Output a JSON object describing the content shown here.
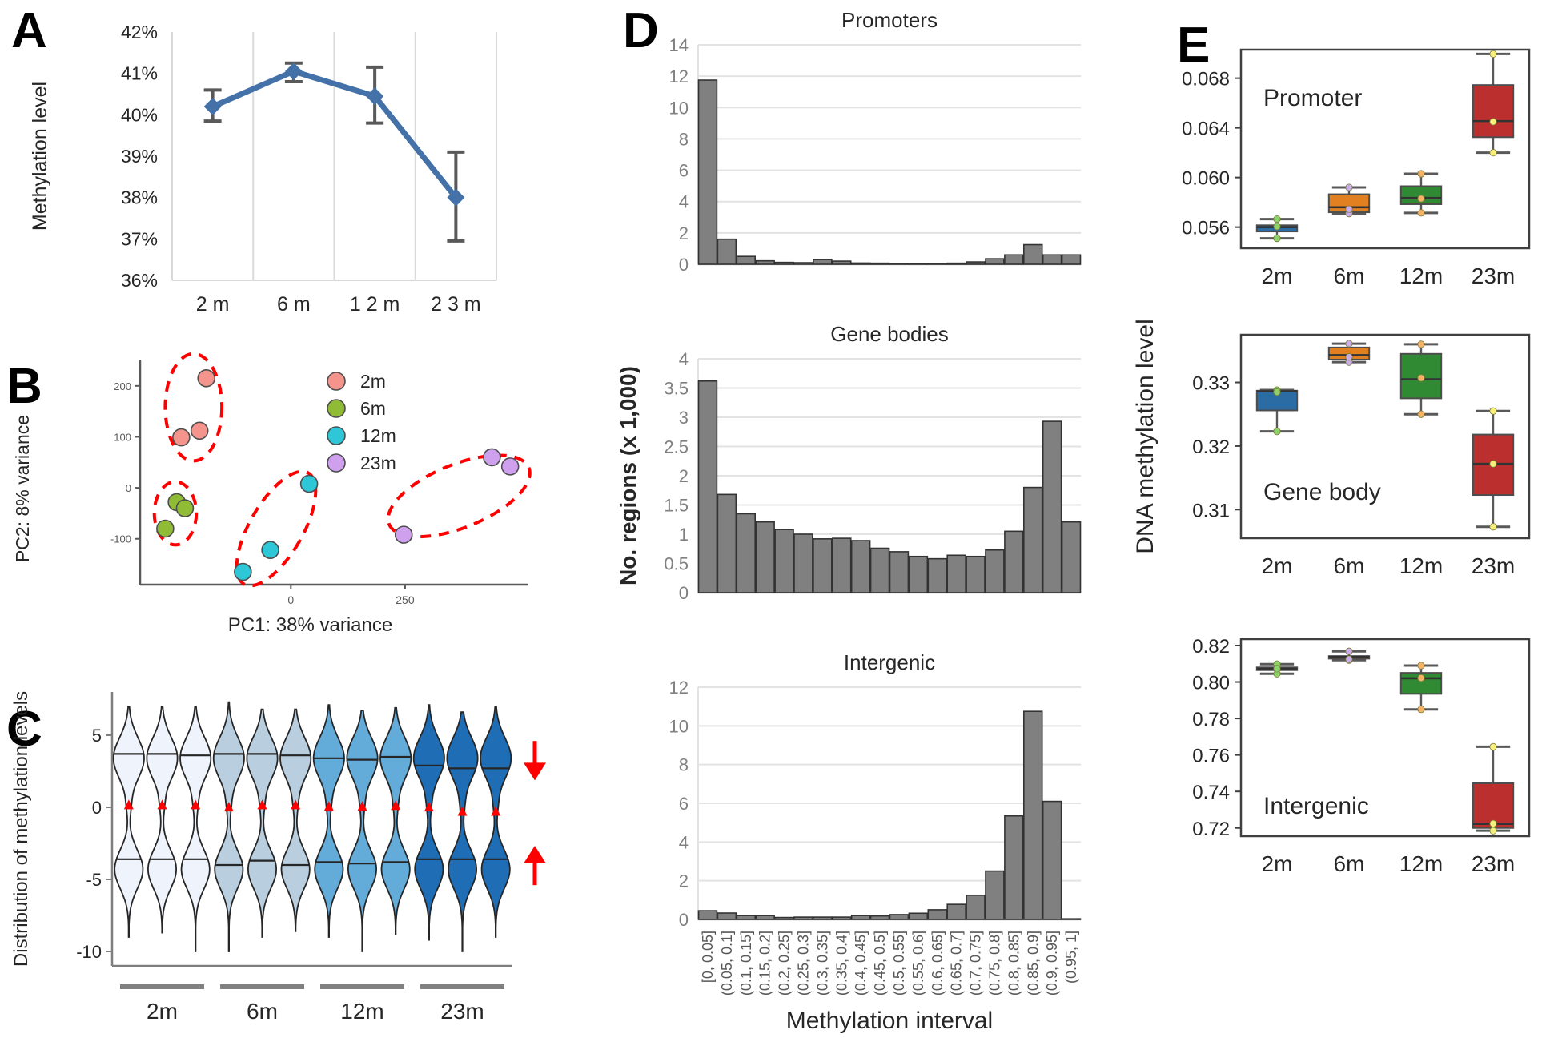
{
  "figure": {
    "panels": [
      "A",
      "B",
      "C",
      "D",
      "E"
    ]
  },
  "panelA": {
    "letter": "A",
    "ylabel": "Methylation level",
    "yticks": [
      "42%",
      "41%",
      "40%",
      "39%",
      "38%",
      "37%",
      "36%"
    ],
    "xticks": [
      "2 m",
      "6 m",
      "1 2 m",
      "2 3 m"
    ],
    "series_color": "#4472a8",
    "errorbar_color": "#595959"
  },
  "panelB": {
    "letter": "B",
    "ylabel": "PC2: 8% variance",
    "xlabel": "PC1: 38% variance",
    "yticks": [
      "200",
      "100",
      "0",
      "-100"
    ],
    "xticks": [
      "0",
      "250"
    ],
    "legend": [
      {
        "label": "2m",
        "color": "#f4948c"
      },
      {
        "label": "6m",
        "color": "#8fbc34"
      },
      {
        "label": "12m",
        "color": "#2ec7d8"
      },
      {
        "label": "23m",
        "color": "#cfa0ee"
      }
    ],
    "cluster_outline_color": "#ff0000"
  },
  "panelC": {
    "letter": "C",
    "ylabel": "Distribution of methylation levels",
    "yticks": [
      "5",
      "0",
      "-5",
      "-10"
    ],
    "group_labels": [
      "2m",
      "6m",
      "12m",
      "23m"
    ],
    "arrow_color": "#ff0000",
    "median_marker_color": "#ff0000",
    "violin_colors": [
      "#eef3fc",
      "#b9cfdf",
      "#63abd8",
      "#1f6eb5"
    ]
  },
  "panelD": {
    "letter": "D",
    "ylabel": "No. regions (x 1,000)",
    "xlabel": "Methylation interval",
    "bar_color": "#808080",
    "bar_edge": "#333333",
    "charts": [
      {
        "title": "Promoters",
        "yticks": [
          "14",
          "12",
          "10",
          "8",
          "6",
          "4",
          "2",
          "0"
        ]
      },
      {
        "title": "Gene bodies",
        "yticks": [
          "4",
          "3.5",
          "3",
          "2.5",
          "2",
          "1.5",
          "1",
          "0.5",
          "0"
        ]
      },
      {
        "title": "Intergenic",
        "yticks": [
          "12",
          "10",
          "8",
          "6",
          "4",
          "2",
          "0"
        ]
      }
    ],
    "xtick_labels": [
      "[0, 0.05]",
      "(0.05, 0.1]",
      "(0.1, 0.15]",
      "(0.15, 0.2]",
      "(0.2, 0.25]",
      "(0.25, 0.3]",
      "(0.3, 0.35]",
      "(0.35, 0.4]",
      "(0.4, 0.45]",
      "(0.45, 0.5]",
      "(0.5, 0.55]",
      "(0.55, 0.6]",
      "(0.6, 0.65]",
      "(0.65, 0.7]",
      "(0.7, 0.75]",
      "(0.75, 0.8]",
      "(0.8, 0.85]",
      "(0.85, 0.9]",
      "(0.9, 0.95]",
      "(0.95, 1]"
    ]
  },
  "panelE": {
    "letter": "E",
    "ylabel": "DNA methylation level",
    "xticks": [
      "2m",
      "6m",
      "12m",
      "23m"
    ],
    "box_colors": [
      "#2a6ca3",
      "#e08020",
      "#2f8a33",
      "#bb2f2f"
    ],
    "charts": [
      {
        "inner_title": "Promoter",
        "yticks": [
          "0.068",
          "0.064",
          "0.060",
          "0.056"
        ]
      },
      {
        "inner_title": "Gene body",
        "yticks": [
          "0.33",
          "0.32",
          "0.31"
        ]
      },
      {
        "inner_title": "Intergenic",
        "yticks": [
          "0.82",
          "0.80",
          "0.78",
          "0.76",
          "0.74",
          "0.72"
        ]
      }
    ]
  },
  "chart_data": [
    {
      "panel": "A",
      "type": "line",
      "title": "",
      "xlabel": "",
      "ylabel": "Methylation level",
      "categories": [
        "2 m",
        "6 m",
        "1 2 m",
        "2 3 m"
      ],
      "values": [
        40.2,
        41.05,
        40.45,
        38.0
      ],
      "error_low": [
        39.85,
        40.8,
        39.8,
        36.95
      ],
      "error_high": [
        40.6,
        41.25,
        41.15,
        39.1
      ],
      "ylim": [
        36,
        42
      ],
      "yticks": [
        36,
        37,
        38,
        39,
        40,
        41,
        42
      ],
      "units": "percent",
      "grid": "vertical",
      "legend": "none"
    },
    {
      "panel": "B",
      "type": "scatter",
      "title": "",
      "xlabel": "PC1: 38% variance",
      "ylabel": "PC2: 8% variance",
      "xlim": [
        -330,
        520
      ],
      "ylim": [
        -190,
        250
      ],
      "xticks": [
        0,
        250
      ],
      "yticks": [
        -100,
        0,
        100,
        200
      ],
      "grid": "off",
      "legend": "inside-right",
      "series": [
        {
          "name": "2m",
          "color": "#f4948c",
          "points": [
            [
              -185,
              215
            ],
            [
              -240,
              99
            ],
            [
              -200,
              112
            ]
          ]
        },
        {
          "name": "6m",
          "color": "#8fbc34",
          "points": [
            [
              -250,
              -28
            ],
            [
              -232,
              -40
            ],
            [
              -275,
              -80
            ]
          ]
        },
        {
          "name": "12m",
          "color": "#2ec7d8",
          "points": [
            [
              40,
              8
            ],
            [
              -45,
              -122
            ],
            [
              -105,
              -165
            ]
          ]
        },
        {
          "name": "23m",
          "color": "#cfa0ee",
          "points": [
            [
              440,
              60
            ],
            [
              480,
              42
            ],
            [
              247,
              -92
            ]
          ]
        }
      ],
      "annotations": [
        {
          "type": "ellipse",
          "label": "2m cluster",
          "color": "#ff0000",
          "style": "dashed"
        },
        {
          "type": "ellipse",
          "label": "6m cluster",
          "color": "#ff0000",
          "style": "dashed"
        },
        {
          "type": "ellipse",
          "label": "12m cluster",
          "color": "#ff0000",
          "style": "dashed"
        },
        {
          "type": "ellipse",
          "label": "23m cluster",
          "color": "#ff0000",
          "style": "dashed"
        }
      ]
    },
    {
      "panel": "C",
      "type": "violin",
      "title": "",
      "xlabel": "",
      "ylabel": "Distribution of methylation levels",
      "ylim": [
        -11,
        8
      ],
      "yticks": [
        -10,
        -5,
        0,
        5
      ],
      "groups": [
        "2m",
        "6m",
        "12m",
        "23m"
      ],
      "replicates_per_group": 3,
      "upper_medians": [
        3.7,
        3.7,
        3.6,
        3.7,
        3.7,
        3.6,
        3.4,
        3.3,
        3.5,
        2.9,
        2.7,
        2.7
      ],
      "lower_medians": [
        -3.6,
        -3.6,
        -3.6,
        -4.0,
        -3.7,
        -4.0,
        -3.8,
        -3.9,
        -3.8,
        -3.6,
        -3.6,
        -3.6
      ],
      "red_triangle_y": [
        0.2,
        0.2,
        0.2,
        0.05,
        0.2,
        0.2,
        0.1,
        0.1,
        0.15,
        0.05,
        -0.25,
        -0.25
      ],
      "whisker_top": [
        7.0,
        7.0,
        7.0,
        7.3,
        6.8,
        6.8,
        7.1,
        6.7,
        6.9,
        7.1,
        6.6,
        7.0
      ],
      "whisker_bottom": [
        -9.0,
        -8.7,
        -10.0,
        -10.0,
        -9.0,
        -8.6,
        -9.0,
        -10.0,
        -8.8,
        -9.2,
        -10.0,
        -9.0
      ],
      "annotations": [
        {
          "type": "arrow",
          "direction": "down",
          "color": "#ff0000",
          "near_y": 3
        },
        {
          "type": "arrow",
          "direction": "up",
          "color": "#ff0000",
          "near_y": -4
        }
      ],
      "grid": "off",
      "legend": "none"
    },
    {
      "panel": "D",
      "chart": "Promoters",
      "type": "bar",
      "title": "Promoters",
      "xlabel": "Methylation interval",
      "ylabel": "No. regions (x 1,000)",
      "categories": [
        "[0, 0.05]",
        "(0.05, 0.1]",
        "(0.1, 0.15]",
        "(0.15, 0.2]",
        "(0.2, 0.25]",
        "(0.25, 0.3]",
        "(0.3, 0.35]",
        "(0.35, 0.4]",
        "(0.4, 0.45]",
        "(0.45, 0.5]",
        "(0.5, 0.55]",
        "(0.55, 0.6]",
        "(0.6, 0.65]",
        "(0.65, 0.7]",
        "(0.7, 0.75]",
        "(0.75, 0.8]",
        "(0.8, 0.85]",
        "(0.85, 0.9]",
        "(0.9, 0.95]",
        "(0.95, 1]"
      ],
      "values": [
        11.75,
        1.6,
        0.5,
        0.22,
        0.12,
        0.1,
        0.3,
        0.2,
        0.08,
        0.07,
        0.05,
        0.03,
        0.05,
        0.07,
        0.15,
        0.35,
        0.6,
        1.25,
        0.6,
        0.6
      ],
      "ylim": [
        0,
        14
      ],
      "yticks": [
        0,
        2,
        4,
        6,
        8,
        10,
        12,
        14
      ],
      "grid": "horizontal"
    },
    {
      "panel": "D",
      "chart": "Gene bodies",
      "type": "bar",
      "title": "Gene bodies",
      "xlabel": "Methylation interval",
      "ylabel": "No. regions (x 1,000)",
      "categories": [
        "[0, 0.05]",
        "(0.05, 0.1]",
        "(0.1, 0.15]",
        "(0.15, 0.2]",
        "(0.2, 0.25]",
        "(0.25, 0.3]",
        "(0.3, 0.35]",
        "(0.35, 0.4]",
        "(0.4, 0.45]",
        "(0.45, 0.5]",
        "(0.5, 0.55]",
        "(0.55, 0.6]",
        "(0.6, 0.65]",
        "(0.65, 0.7]",
        "(0.7, 0.75]",
        "(0.75, 0.8]",
        "(0.8, 0.85]",
        "(0.85, 0.9]",
        "(0.9, 0.95]",
        "(0.95, 1]"
      ],
      "values": [
        3.62,
        1.68,
        1.35,
        1.21,
        1.08,
        1.0,
        0.92,
        0.93,
        0.89,
        0.76,
        0.7,
        0.62,
        0.58,
        0.64,
        0.62,
        0.73,
        1.05,
        1.8,
        2.93,
        1.21
      ],
      "ylim": [
        0,
        4
      ],
      "yticks": [
        0,
        0.5,
        1,
        1.5,
        2,
        2.5,
        3,
        3.5,
        4
      ],
      "grid": "horizontal"
    },
    {
      "panel": "D",
      "chart": "Intergenic",
      "type": "bar",
      "title": "Intergenic",
      "xlabel": "Methylation interval",
      "ylabel": "No. regions (x 1,000)",
      "categories": [
        "[0, 0.05]",
        "(0.05, 0.1]",
        "(0.1, 0.15]",
        "(0.15, 0.2]",
        "(0.2, 0.25]",
        "(0.25, 0.3]",
        "(0.3, 0.35]",
        "(0.35, 0.4]",
        "(0.4, 0.45]",
        "(0.45, 0.5]",
        "(0.5, 0.55]",
        "(0.55, 0.6]",
        "(0.6, 0.65]",
        "(0.65, 0.7]",
        "(0.7, 0.75]",
        "(0.75, 0.8]",
        "(0.8, 0.85]",
        "(0.85, 0.9]",
        "(0.9, 0.95]",
        "(0.95, 1]"
      ],
      "values": [
        0.45,
        0.33,
        0.2,
        0.2,
        0.1,
        0.12,
        0.12,
        0.12,
        0.2,
        0.18,
        0.25,
        0.32,
        0.5,
        0.78,
        1.25,
        2.5,
        5.35,
        10.75,
        6.1,
        0.0
      ],
      "ylim": [
        0,
        12
      ],
      "yticks": [
        0,
        2,
        4,
        6,
        8,
        10,
        12
      ],
      "grid": "horizontal"
    },
    {
      "panel": "E",
      "chart": "Promoter",
      "type": "boxplot",
      "title": "Promoter",
      "xlabel": "",
      "ylabel": "DNA methylation level",
      "categories": [
        "2m",
        "6m",
        "12m",
        "23m"
      ],
      "ylim": [
        0.0543,
        0.0703
      ],
      "yticks": [
        0.056,
        0.06,
        0.064,
        0.068
      ],
      "boxes": [
        {
          "name": "2m",
          "color": "#2a6ca3",
          "whisker_low": 0.0551,
          "q1": 0.05565,
          "median": 0.056,
          "q3": 0.05615,
          "whisker_high": 0.05665,
          "point": 0.05605
        },
        {
          "name": "6m",
          "color": "#e08020",
          "whisker_low": 0.0571,
          "q1": 0.0572,
          "median": 0.0576,
          "q3": 0.05865,
          "whisker_high": 0.0592,
          "point": 0.05745
        },
        {
          "name": "12m",
          "color": "#2f8a33",
          "whisker_low": 0.05715,
          "q1": 0.05785,
          "median": 0.05835,
          "q3": 0.0593,
          "whisker_high": 0.0603,
          "point": 0.0583
        },
        {
          "name": "23m",
          "color": "#bb2f2f",
          "whisker_low": 0.062,
          "q1": 0.06325,
          "median": 0.06455,
          "q3": 0.06745,
          "whisker_high": 0.06995,
          "point": 0.0645
        }
      ]
    },
    {
      "panel": "E",
      "chart": "Gene body",
      "type": "boxplot",
      "title": "Gene body",
      "xlabel": "",
      "ylabel": "DNA methylation level",
      "categories": [
        "2m",
        "6m",
        "12m",
        "23m"
      ],
      "ylim": [
        0.3055,
        0.3375
      ],
      "yticks": [
        0.31,
        0.32,
        0.33
      ],
      "boxes": [
        {
          "name": "2m",
          "color": "#2a6ca3",
          "whisker_low": 0.3223,
          "q1": 0.3256,
          "median": 0.3286,
          "q3": 0.3287,
          "whisker_high": 0.3288,
          "point": 0.3285
        },
        {
          "name": "6m",
          "color": "#e08020",
          "whisker_low": 0.3332,
          "q1": 0.3336,
          "median": 0.3343,
          "q3": 0.3355,
          "whisker_high": 0.3361,
          "point": 0.334
        },
        {
          "name": "12m",
          "color": "#2f8a33",
          "whisker_low": 0.325,
          "q1": 0.3275,
          "median": 0.3305,
          "q3": 0.3345,
          "whisker_high": 0.336,
          "point": 0.3307
        },
        {
          "name": "23m",
          "color": "#bb2f2f",
          "whisker_low": 0.3073,
          "q1": 0.3123,
          "median": 0.3172,
          "q3": 0.3218,
          "whisker_high": 0.3255,
          "point": 0.3172
        }
      ]
    },
    {
      "panel": "E",
      "chart": "Intergenic",
      "type": "boxplot",
      "title": "Intergenic",
      "xlabel": "",
      "ylabel": "DNA methylation level",
      "categories": [
        "2m",
        "6m",
        "12m",
        "23m"
      ],
      "ylim": [
        0.7155,
        0.8235
      ],
      "yticks": [
        0.72,
        0.74,
        0.76,
        0.78,
        0.8,
        0.82
      ],
      "boxes": [
        {
          "name": "2m",
          "color": "#2a6ca3",
          "whisker_low": 0.8045,
          "q1": 0.8065,
          "median": 0.8073,
          "q3": 0.808,
          "whisker_high": 0.8098,
          "point": 0.8073
        },
        {
          "name": "6m",
          "color": "#e08020",
          "whisker_low": 0.812,
          "q1": 0.8128,
          "median": 0.8138,
          "q3": 0.8142,
          "whisker_high": 0.8168,
          "point": 0.8125
        },
        {
          "name": "12m",
          "color": "#2f8a33",
          "whisker_low": 0.785,
          "q1": 0.7935,
          "median": 0.802,
          "q3": 0.805,
          "whisker_high": 0.809,
          "point": 0.8022
        },
        {
          "name": "23m",
          "color": "#bb2f2f",
          "whisker_low": 0.7185,
          "q1": 0.72,
          "median": 0.7222,
          "q3": 0.7445,
          "whisker_high": 0.7645,
          "point": 0.7224
        }
      ]
    }
  ]
}
